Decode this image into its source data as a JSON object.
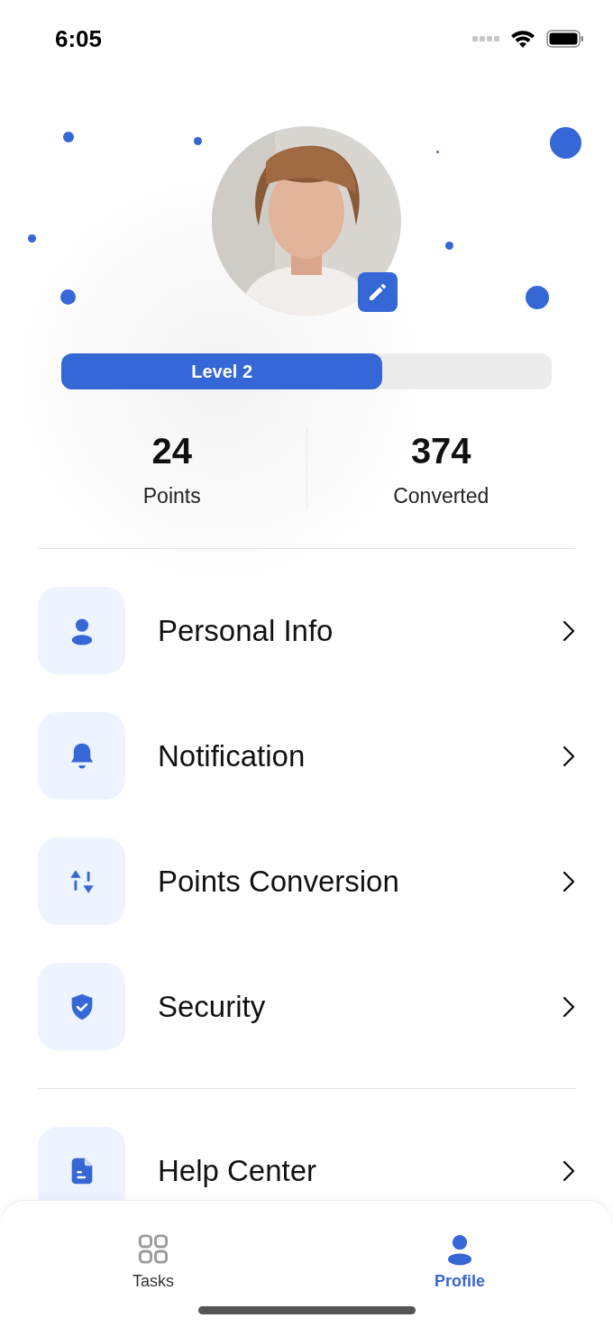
{
  "status_bar": {
    "time": "6:05"
  },
  "profile": {
    "level": {
      "label": "Level 2",
      "level": 0.655
    },
    "stats": [
      {
        "value": "24",
        "label": "Points"
      },
      {
        "value": "374",
        "label": "Converted"
      }
    ]
  },
  "menu_groups": [
    [
      {
        "kind": "person",
        "label": "Personal Info"
      },
      {
        "kind": "bell",
        "label": "Notification"
      },
      {
        "kind": "convert",
        "label": "Points Conversion"
      },
      {
        "kind": "shield",
        "label": "Security"
      }
    ],
    [
      {
        "kind": "document",
        "label": "Help Center"
      }
    ]
  ],
  "tab_bar": [
    {
      "kind": "grid",
      "label": "Tasks",
      "selected": false
    },
    {
      "kind": "person",
      "label": "Profile",
      "selected": true
    }
  ]
}
